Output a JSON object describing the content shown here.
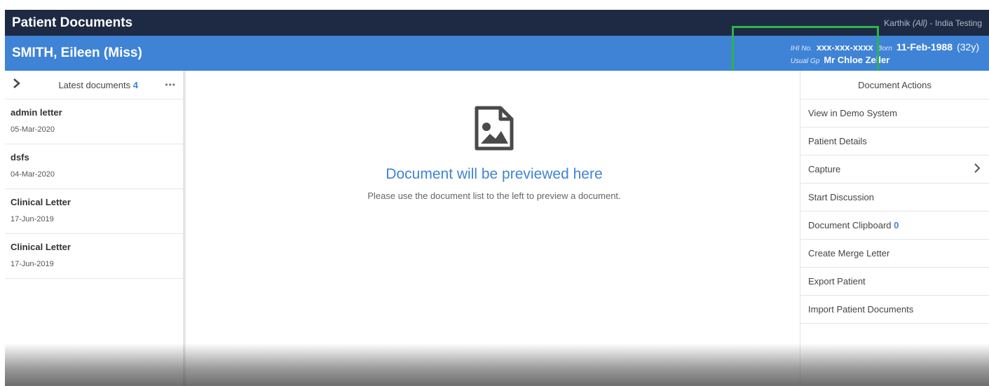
{
  "app": {
    "title": "Patient Documents",
    "user_name": "Karthik",
    "user_scope": "(All)",
    "user_org": " - India Testing"
  },
  "patient": {
    "name": "SMITH, Eileen (Miss)",
    "ihi_label": "IHI No.",
    "ihi_value": "xxx-xxx-xxxx",
    "born_label": "Born",
    "dob": "11-Feb-1988",
    "age": "(32y)",
    "gp_label": "Usual Gp",
    "gp_value": "Mr Chloe Zeller"
  },
  "documents": {
    "header_label": "Latest documents",
    "count": "4",
    "items": [
      {
        "title": "admin letter",
        "date": "05-Mar-2020"
      },
      {
        "title": "dsfs",
        "date": "04-Mar-2020"
      },
      {
        "title": "Clinical Letter",
        "date": "17-Jun-2019"
      },
      {
        "title": "Clinical Letter",
        "date": "17-Jun-2019"
      }
    ]
  },
  "preview": {
    "icon": "image-file-icon",
    "title": "Document will be previewed here",
    "subtitle": "Please use the document list to the left to preview a document."
  },
  "actions": {
    "header": "Document Actions",
    "items": [
      {
        "label": "View in Demo System"
      },
      {
        "label": "Patient Details"
      },
      {
        "label": "Capture"
      },
      {
        "label": "Start Discussion"
      },
      {
        "label": "Document Clipboard",
        "count": "0"
      },
      {
        "label": "Create Merge Letter"
      },
      {
        "label": "Export Patient"
      },
      {
        "label": "Import Patient Documents"
      }
    ]
  },
  "colors": {
    "header_bg": "#1e2a44",
    "patient_bg": "#3f83d6",
    "accent": "#3f83d6",
    "highlight": "#2db34a"
  }
}
